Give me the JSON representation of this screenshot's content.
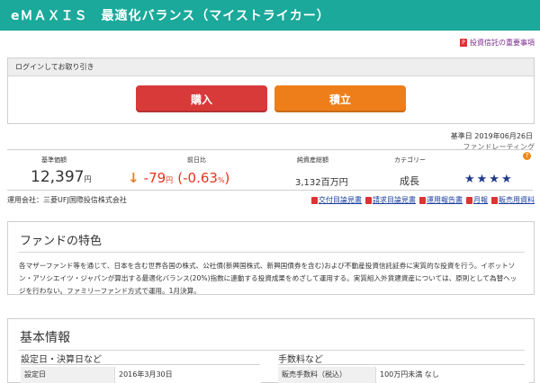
{
  "header": {
    "title": "eＭＡＸＩＳ　最適化バランス（マイストライカー）"
  },
  "notice": {
    "label": "投資信託の重要事項"
  },
  "trade": {
    "section_label": "ログインしてお取り引き",
    "buy_label": "購入",
    "tsumitate_label": "積立"
  },
  "base_date": "基準日 2019年06月26日",
  "rating": {
    "label": "ファンドレーティング",
    "stars": "★★★★"
  },
  "stats": {
    "nav_header": "基準価額",
    "nav_value": "12,397",
    "nav_unit": "円",
    "change_header": "前日比",
    "change_value": "-79",
    "change_unit": "円",
    "change_pct": "(-0.63",
    "pct_unit": "%",
    "pct_close": ")",
    "assets_header": "純資産総額",
    "assets_value": "3,132百万円",
    "category_header": "カテゴリー",
    "category_value": "成長"
  },
  "company": "運用会社：三菱UFJ国際投信株式会社",
  "links": [
    "交付目論見書",
    "請求目論見書",
    "運用報告書",
    "月報",
    "販売用資料"
  ],
  "features": {
    "title": "ファンドの特色",
    "text": "各マザーファンド等を通じて、日本を含む世界各国の株式、公社債(新興国株式、新興国債券を含む)および不動産投資信託証券に実質的な投資を行う。イボットソン・アソシエイツ・ジャパンが算出する最適化バランス(20%)指数に連動する投資成果をめざして運用する。実質組入外貨建資産については、原則として為替ヘッジを行わない。ファミリーファンド方式で運用。1月決算。"
  },
  "basic": {
    "title": "基本情報",
    "left_sub": "設定日・決算日など",
    "right_sub": "手数料など",
    "rows_left": [
      {
        "label": "設定日",
        "value": "2016年3月30日"
      }
    ],
    "rows_right": [
      {
        "label": "販売手数料（税込）",
        "value": "100万円未満 なし"
      }
    ]
  }
}
